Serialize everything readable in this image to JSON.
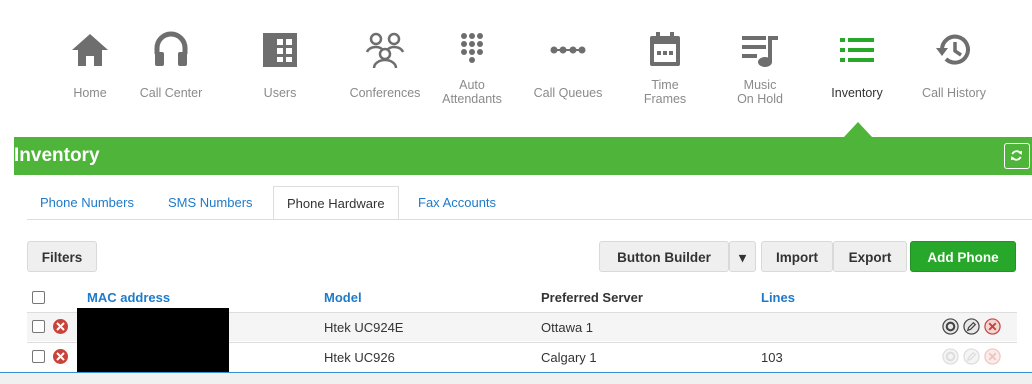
{
  "nav": {
    "items": [
      {
        "label": "Home",
        "icon": "home-icon"
      },
      {
        "label": "Call Center",
        "icon": "headset-icon"
      },
      {
        "label": "Users",
        "icon": "users-icon"
      },
      {
        "label": "Conferences",
        "icon": "conferences-icon"
      },
      {
        "label": "Auto Attendants",
        "icon": "keypad-icon"
      },
      {
        "label": "Call Queues",
        "icon": "queue-icon"
      },
      {
        "label": "Time Frames",
        "icon": "calendar-icon"
      },
      {
        "label": "Music On Hold",
        "icon": "music-icon"
      },
      {
        "label": "Inventory",
        "icon": "list-icon"
      },
      {
        "label": "Call History",
        "icon": "history-icon"
      }
    ],
    "active": "Inventory"
  },
  "header": {
    "title": "Inventory",
    "refresh_icon": "refresh-icon"
  },
  "tabs": [
    "Phone Numbers",
    "SMS Numbers",
    "Phone Hardware",
    "Fax Accounts"
  ],
  "active_tab": "Phone Hardware",
  "toolbar": {
    "filters": "Filters",
    "button_builder": "Button Builder",
    "dropdown_caret": "▾",
    "import": "Import",
    "export": "Export",
    "add_phone": "Add Phone"
  },
  "table": {
    "columns": [
      "MAC address",
      "Model",
      "Preferred Server",
      "Lines"
    ],
    "rows": [
      {
        "mac": "",
        "model": "Htek UC924E",
        "server": "Ottawa 1",
        "lines": ""
      },
      {
        "mac": "",
        "model": "Htek UC926",
        "server": "Calgary 1",
        "lines": "103"
      }
    ]
  },
  "colors": {
    "green": "#4fb43a",
    "add_button": "#27a82a",
    "link": "#1f7ac9",
    "error": "#c7443a"
  }
}
